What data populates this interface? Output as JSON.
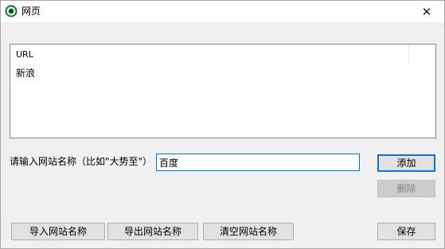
{
  "window": {
    "title": "网页",
    "close_glyph": "✕",
    "icon": "app-globe-icon",
    "accent_color": "#0078d7"
  },
  "list": {
    "column_header": "URL",
    "rows": [
      "新浪"
    ]
  },
  "form": {
    "label": "请输入网站名称（比如\"大势至\"）",
    "input_value": "百度"
  },
  "buttons": {
    "add": "添加",
    "delete": "删除",
    "import": "导入网站名称",
    "export": "导出网站名称",
    "clear": "清空网站名称",
    "save": "保存"
  }
}
